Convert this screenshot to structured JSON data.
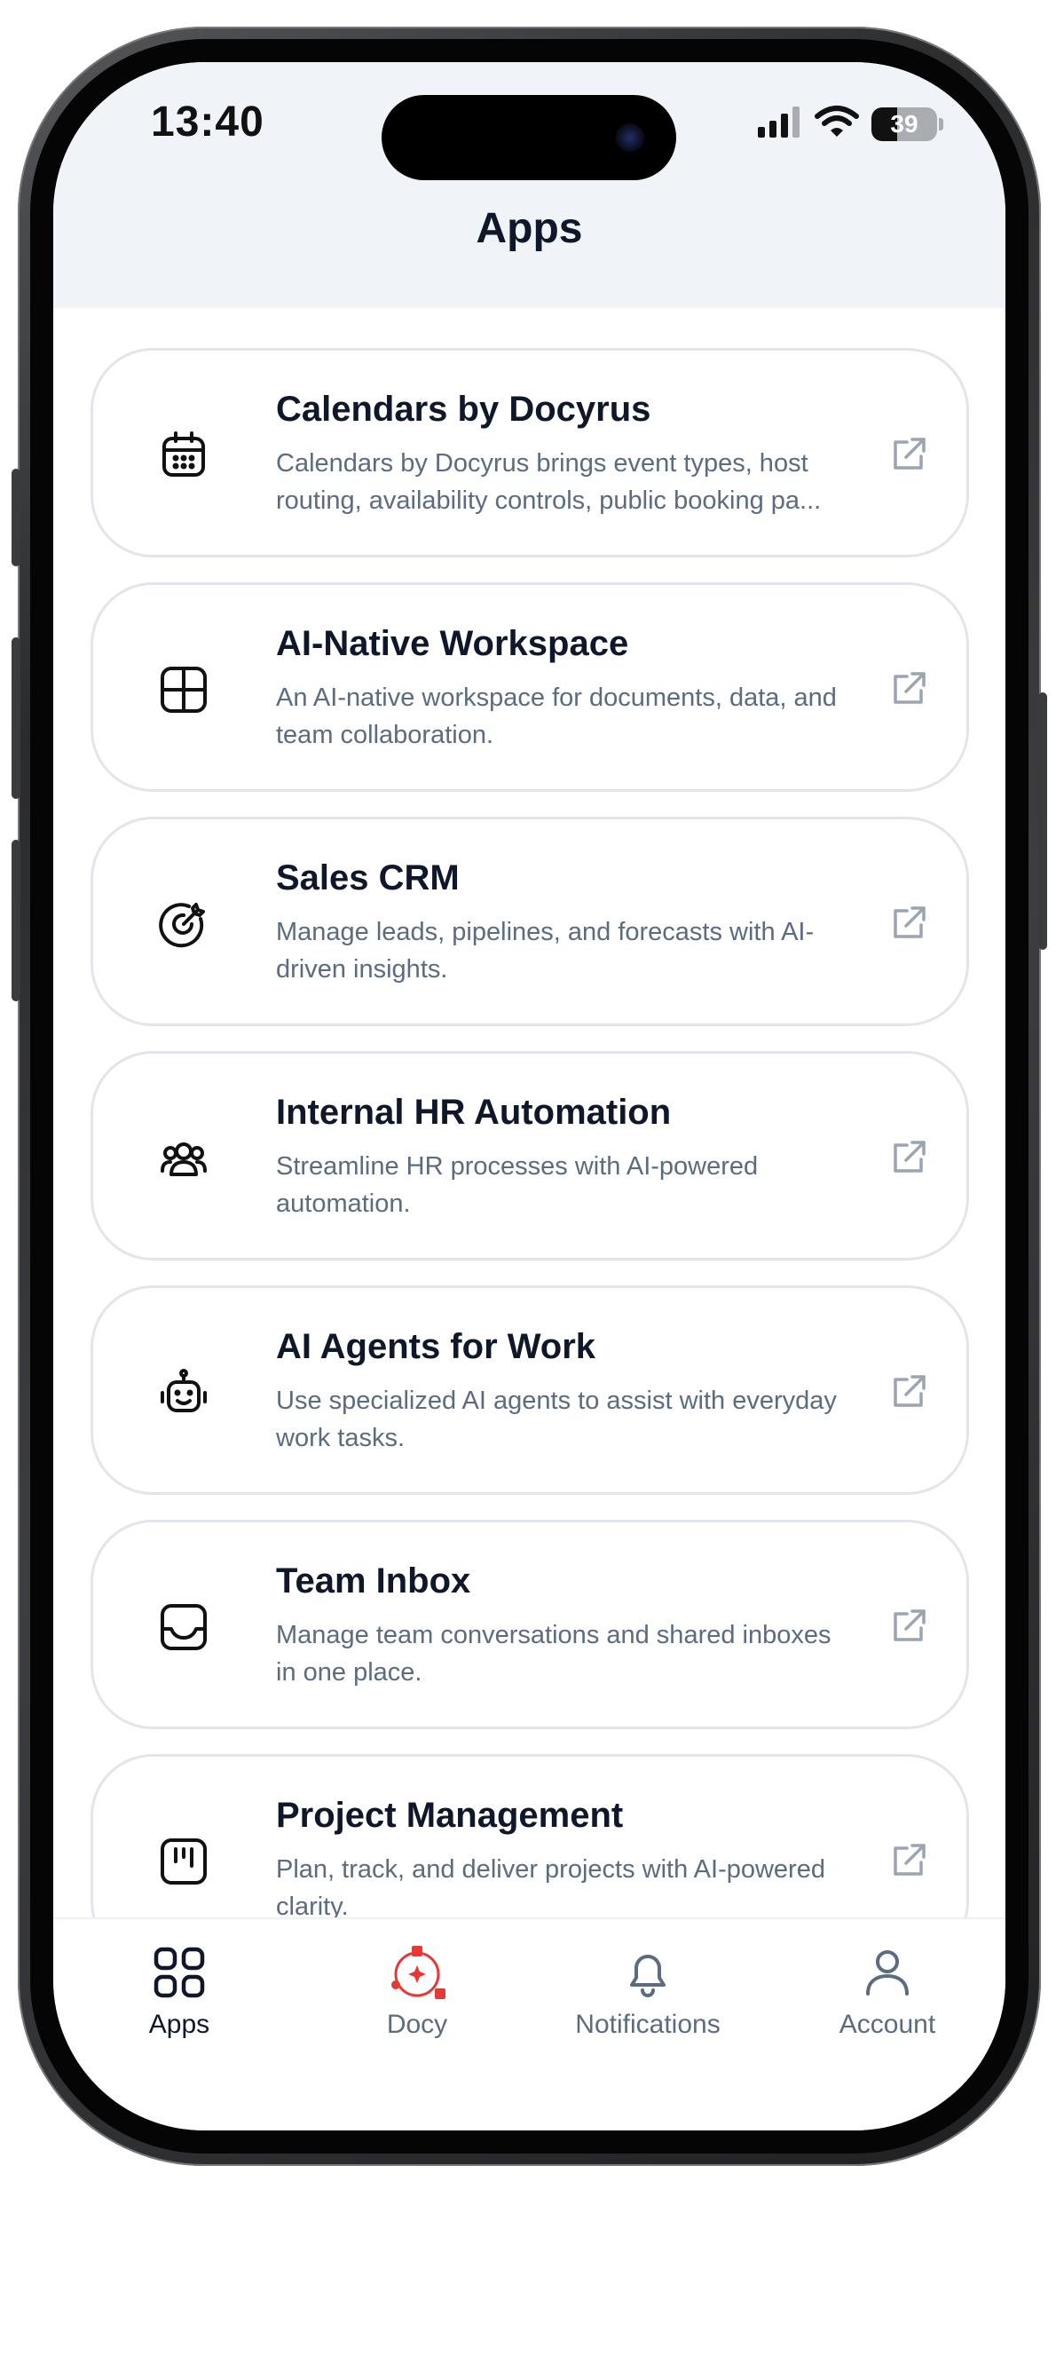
{
  "status_bar": {
    "time": "13:40",
    "battery_level": "39",
    "battery_fraction": 0.39
  },
  "header": {
    "title": "Apps"
  },
  "apps": [
    {
      "name": "Calendars by Docyrus",
      "description": "Calendars by Docyrus brings event types, host routing, availability controls, public booking pa...",
      "icon": "calendar-icon"
    },
    {
      "name": "AI-Native Workspace",
      "description": "An AI-native workspace for documents, data, and team collaboration.",
      "icon": "layout-grid-icon"
    },
    {
      "name": "Sales CRM",
      "description": "Manage leads, pipelines, and forecasts with AI-driven insights.",
      "icon": "target-icon"
    },
    {
      "name": "Internal HR Automation",
      "description": "Streamline HR processes with AI-powered automation.",
      "icon": "users-icon"
    },
    {
      "name": "AI Agents for Work",
      "description": "Use specialized AI agents to assist with everyday work tasks.",
      "icon": "robot-icon"
    },
    {
      "name": "Team Inbox",
      "description": "Manage team conversations and shared inboxes in one place.",
      "icon": "inbox-icon"
    },
    {
      "name": "Project Management",
      "description": "Plan, track, and deliver projects with AI-powered clarity.",
      "icon": "kanban-icon"
    }
  ],
  "bottom_nav": [
    {
      "label": "Apps",
      "icon": "apps-grid-icon",
      "active": true
    },
    {
      "label": "Docy",
      "icon": "docy-logo-icon",
      "active": false
    },
    {
      "label": "Notifications",
      "icon": "bell-icon",
      "active": false
    },
    {
      "label": "Account",
      "icon": "user-icon",
      "active": false
    }
  ],
  "colors": {
    "header_bg": "#f0f3f8",
    "title_text": "#0f172a",
    "muted_text": "#5b6b80",
    "card_border": "#e2e6ec",
    "docy_accent": "#e53935"
  }
}
